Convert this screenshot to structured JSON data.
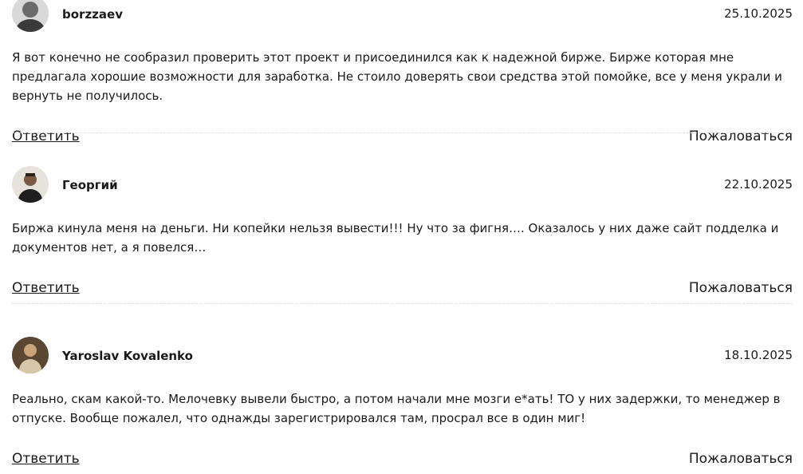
{
  "comments": [
    {
      "author": "borzzaev",
      "date": "25.10.2025",
      "text": "Я вот конечно не сообразил проверить этот проект и присоединился как к надежной бирже. Бирже которая мне предлагала хорошие возможности для заработка. Не стоило доверять свои средства этой помойке, все у меня украли и вернуть не получилось.",
      "reply_label": "Ответить",
      "report_label": "Пожаловаться",
      "avatar": "user-avatar-icon"
    },
    {
      "author": "Георгий",
      "date": "22.10.2025",
      "text": "Биржа кинула меня на деньги. Ни копейки нельзя вывести!!! Ну что за фигня…. Оказалось у них даже сайт подделка и документов нет, а я повелся…",
      "reply_label": "Ответить",
      "report_label": "Пожаловаться",
      "avatar": "user-avatar-icon"
    },
    {
      "author": "Yaroslav Kovalenko",
      "date": "18.10.2025",
      "text": "Реально, скам какой-то. Мелочевку вывели быстро, а потом начали мне мозги е*ать! ТО у них задержки, то менеджер в отпуске. Вообще пожалел, что однажды зарегистрировался там, просрал все в один миг!",
      "reply_label": "Ответить",
      "report_label": "Пожаловаться",
      "avatar": "user-avatar-icon"
    }
  ]
}
